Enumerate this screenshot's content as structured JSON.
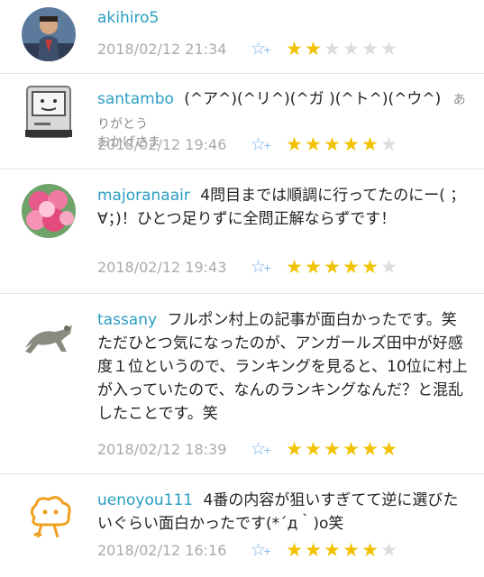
{
  "comments": [
    {
      "username": "akihiro5",
      "extra": "",
      "text": "",
      "date": "2018/02/12 21:34",
      "rating": 2,
      "avatar_icon": "man-portrait-icon"
    },
    {
      "username": "santambo",
      "extra": "ありがとう",
      "text": "(^ア^)(^リ^)(^ガ )(^ト^)(^ウ^)",
      "extra2": "おかげさま",
      "date": "2018/02/12 19:46",
      "rating": 5,
      "avatar_icon": "retro-computer-icon"
    },
    {
      "username": "majoranaair",
      "extra": "",
      "text": "4問目までは順調に行ってたのにー( ；∀；)！ひとつ足りずに全問正解ならずです！",
      "date": "2018/02/12 19:43",
      "rating": 5,
      "avatar_icon": "pink-roses-icon"
    },
    {
      "username": "tassany",
      "extra": "",
      "text": "フルポン村上の記事が面白かったです。笑　ただひとつ気になったのが、アンガールズ田中が好感度１位というので、ランキングを見ると、10位に村上が入っていたので、なんのランキングなんだ？と混乱したことです。笑",
      "date": "2018/02/12 18:39",
      "rating": 6,
      "avatar_icon": "leaping-cat-icon"
    },
    {
      "username": "uenoyou111",
      "extra": "",
      "text": "4番の内容が狙いすぎてて逆に選びたいぐらい面白かったです(*´д｀)o笑",
      "date": "2018/02/12 16:16",
      "rating": 5,
      "avatar_icon": "orange-cloud-character-icon"
    }
  ],
  "fav_label": "☆+",
  "colors": {
    "username": "#2a9ec2",
    "star_on": "#f2c200",
    "star_off": "#dddddd",
    "date": "#aaaaaa"
  }
}
